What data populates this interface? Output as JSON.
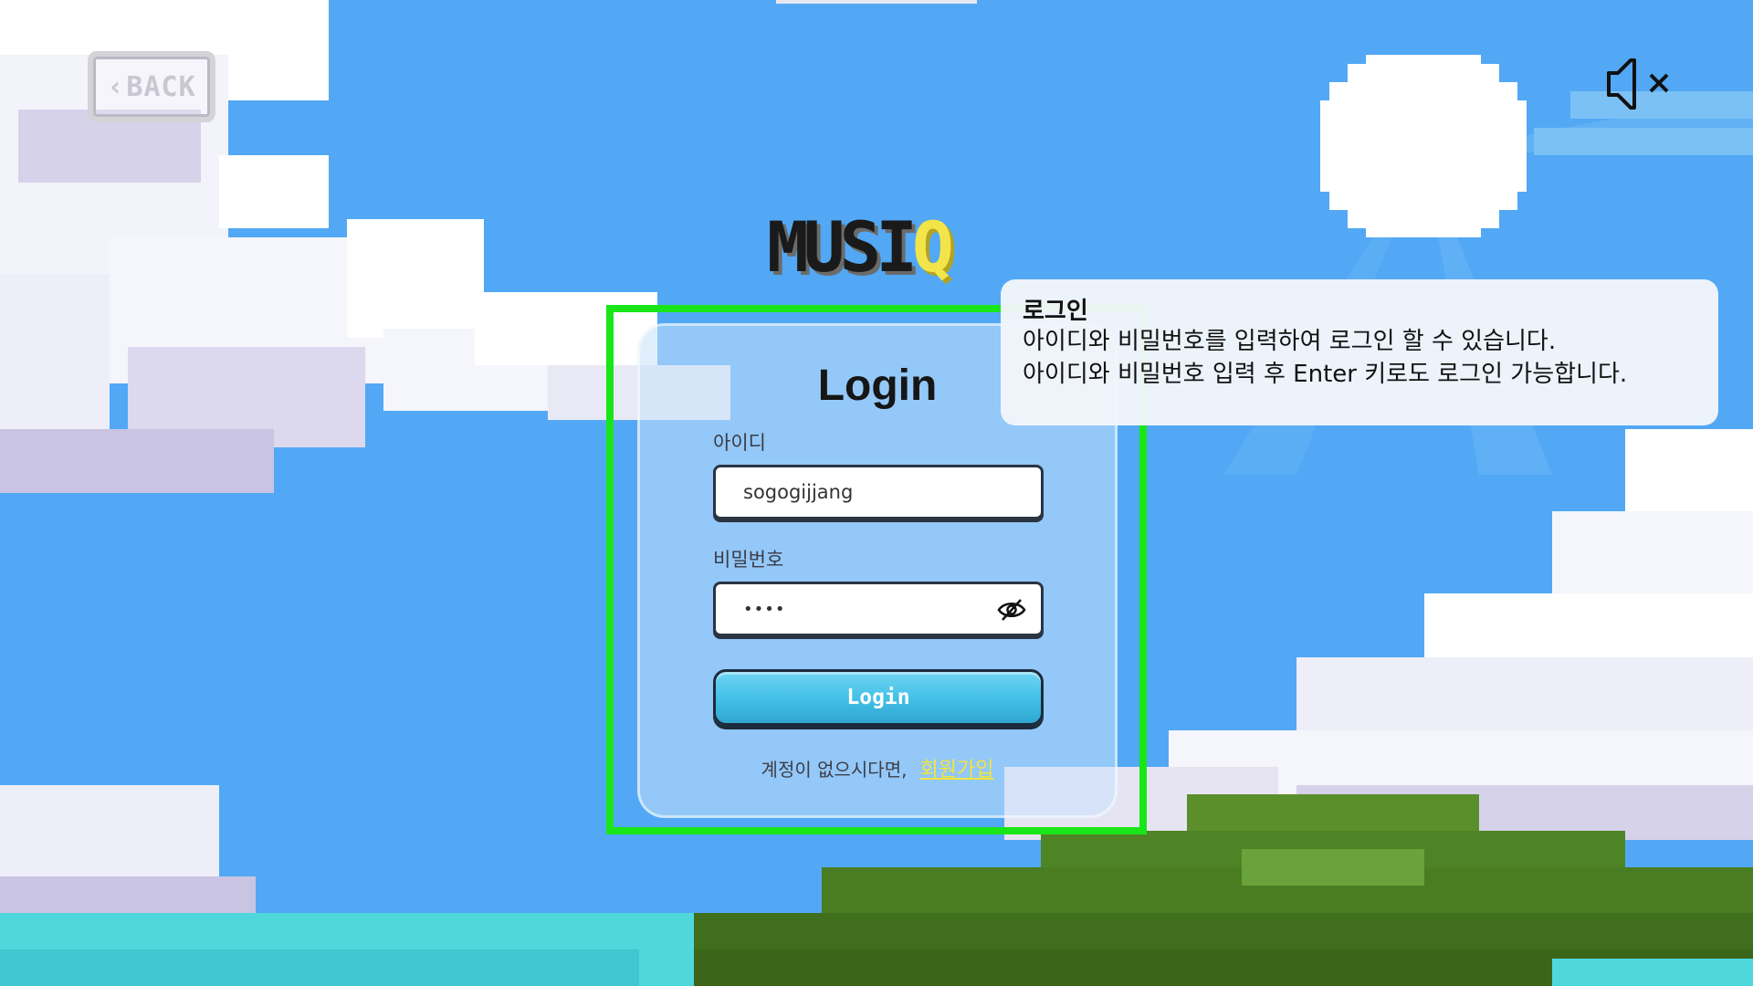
{
  "header": {
    "back_label": "BACK",
    "mute_icon": "speaker-muted-icon"
  },
  "logo": {
    "text_main": "MUSI",
    "text_accent": "Q"
  },
  "login_card": {
    "title": "Login",
    "id_label": "아이디",
    "id_value": "sogogijjang",
    "password_label": "비밀번호",
    "password_masked": "••••",
    "password_toggle_icon": "eye-off-icon",
    "submit_label": "Login",
    "signup_prompt": "계정이 없으시다면,",
    "signup_link": "회원가입"
  },
  "tooltip": {
    "title": "로그인",
    "line1": "아이디와 비밀번호를 입력하여 로그인 할 수 있습니다.",
    "line2": "아이디와 비밀번호 입력 후 Enter 키로도 로그인 가능합니다."
  },
  "colors": {
    "sky": "#52a8f4",
    "highlight": "#19e619",
    "button": "#45c1e8",
    "link": "#f2e43f"
  }
}
